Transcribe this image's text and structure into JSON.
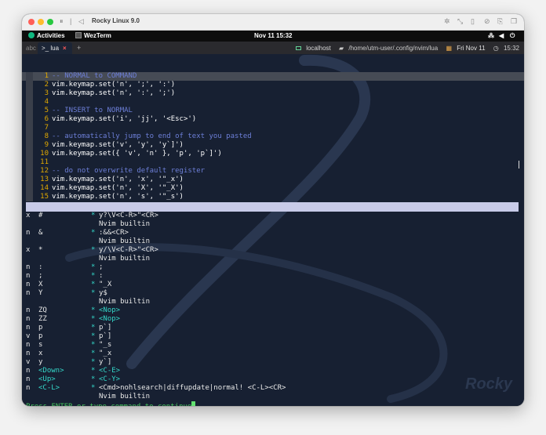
{
  "window": {
    "title": "Rocky Linux 9.0",
    "icons": [
      "settings-icon",
      "resize-icon",
      "usb-icon",
      "share-icon",
      "tools-icon",
      "window-icon"
    ]
  },
  "gnome": {
    "activities": "Activities",
    "app_name": "WezTerm",
    "clock": "Nov 11  15:32"
  },
  "tabbar": {
    "inactive_tab": "abc",
    "active_tab": ">_ lua",
    "close": "×",
    "new_tab": "+",
    "status": {
      "host": "localhost",
      "cwd": "/home/utm-user/.config/nvim/lua",
      "date": "Fri Nov 11",
      "time": "15:32"
    }
  },
  "editor": {
    "lines": [
      {
        "num": "1",
        "code": "-- NORMAL to COMMAND",
        "kind": "comment"
      },
      {
        "num": "2",
        "code": "vim.keymap.set('n', ';', ':')",
        "kind": "code"
      },
      {
        "num": "3",
        "code": "vim.keymap.set('n', ':', ';')",
        "kind": "code"
      },
      {
        "num": "4",
        "code": "",
        "kind": "code"
      },
      {
        "num": "5",
        "code": "-- INSERT to NORMAL",
        "kind": "comment"
      },
      {
        "num": "6",
        "code": "vim.keymap.set('i', 'jj', '<Esc>')",
        "kind": "code"
      },
      {
        "num": "7",
        "code": "",
        "kind": "code"
      },
      {
        "num": "8",
        "code": "-- automatically jump to end of text you pasted",
        "kind": "comment"
      },
      {
        "num": "9",
        "code": "vim.keymap.set('v', 'y', 'y`]')",
        "kind": "code"
      },
      {
        "num": "10",
        "code": "vim.keymap.set({ 'v', 'n' }, 'p', 'p`]')",
        "kind": "code"
      },
      {
        "num": "11",
        "code": "",
        "kind": "code"
      },
      {
        "num": "12",
        "code": "-- do not overwrite default register",
        "kind": "comment"
      },
      {
        "num": "13",
        "code": "vim.keymap.set('n', 'x', '\"_x')",
        "kind": "code"
      },
      {
        "num": "14",
        "code": "vim.keymap.set('n', 'X', '\"_X')",
        "kind": "code"
      },
      {
        "num": "15",
        "code": "vim.keymap.set('n', 's', '\"_s')",
        "kind": "code"
      }
    ]
  },
  "mappings": [
    {
      "mode": "x",
      "lhs": "#",
      "star": "*",
      "rhs": "y?\\V<C-R>\"<CR>",
      "desc": "Nvim builtin"
    },
    {
      "mode": "n",
      "lhs": "&",
      "star": "*",
      "rhs": ":&&<CR>",
      "desc": "Nvim builtin"
    },
    {
      "mode": "x",
      "lhs": "*",
      "star": "*",
      "rhs": "y/\\V<C-R>\"<CR>",
      "desc": "Nvim builtin"
    },
    {
      "mode": "n",
      "lhs": ":",
      "star": "*",
      "rhs": ";",
      "desc": ""
    },
    {
      "mode": "n",
      "lhs": ";",
      "star": "*",
      "rhs": ":",
      "desc": ""
    },
    {
      "mode": "n",
      "lhs": "X",
      "star": "*",
      "rhs": "\"_X",
      "desc": ""
    },
    {
      "mode": "n",
      "lhs": "Y",
      "star": "*",
      "rhs": "y$",
      "desc": "Nvim builtin"
    },
    {
      "mode": "n",
      "lhs": "ZQ",
      "star": "*",
      "rhs": "<Nop>",
      "desc": ""
    },
    {
      "mode": "n",
      "lhs": "ZZ",
      "star": "*",
      "rhs": "<Nop>",
      "desc": ""
    },
    {
      "mode": "n",
      "lhs": "p",
      "star": "*",
      "rhs": "p`]",
      "desc": ""
    },
    {
      "mode": "v",
      "lhs": "p",
      "star": "*",
      "rhs": "p`]",
      "desc": ""
    },
    {
      "mode": "n",
      "lhs": "s",
      "star": "*",
      "rhs": "\"_s",
      "desc": ""
    },
    {
      "mode": "n",
      "lhs": "x",
      "star": "*",
      "rhs": "\"_x",
      "desc": ""
    },
    {
      "mode": "v",
      "lhs": "y",
      "star": "*",
      "rhs": "y`]",
      "desc": ""
    },
    {
      "mode": "n",
      "lhs": "<Down>",
      "star": "*",
      "rhs": "<C-E>",
      "desc": ""
    },
    {
      "mode": "n",
      "lhs": "<Up>",
      "star": "*",
      "rhs": "<C-Y>",
      "desc": ""
    },
    {
      "mode": "n",
      "lhs": "<C-L>",
      "star": "*",
      "rhs": "<Cmd>nohlsearch|diffupdate|normal! <C-L><CR>",
      "desc": "Nvim builtin"
    }
  ],
  "prompt": "Press ENTER or type command to continue",
  "watermark": "Rocky",
  "colors": {
    "terminal_bg": "#172032",
    "line_number": "#e0a800",
    "comment": "#6d7fd8",
    "special_key": "#34d6c8",
    "prompt": "#45c45c"
  }
}
